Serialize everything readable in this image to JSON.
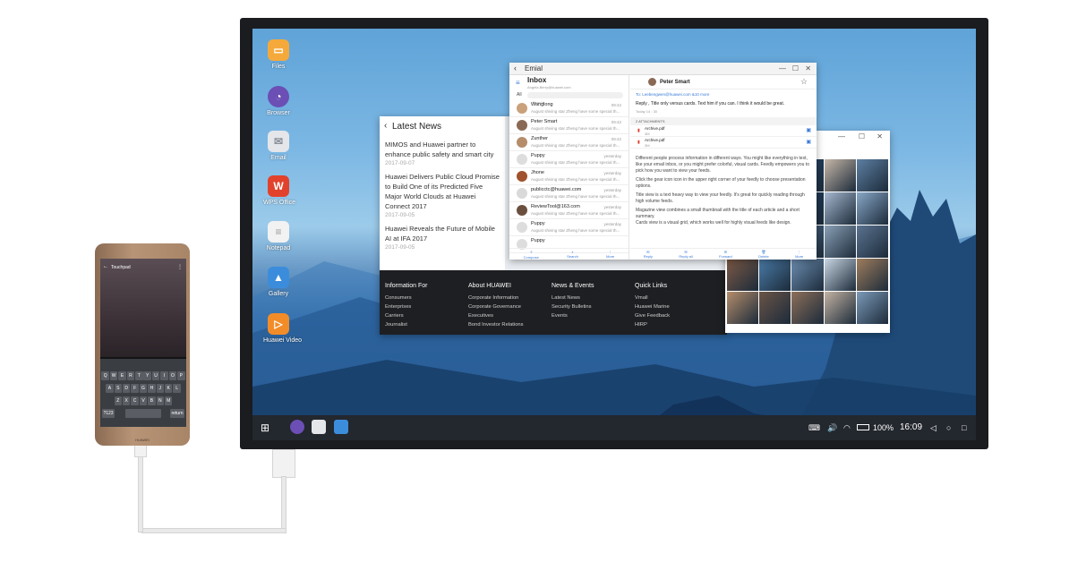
{
  "desktop": {
    "icons": [
      {
        "label": "Files",
        "color": "#f5a93b",
        "icon": "folder-icon"
      },
      {
        "label": "Browser",
        "color": "#6b4fb5",
        "icon": "browser-icon"
      },
      {
        "label": "Email",
        "color": "#e4e6ea",
        "icon": "mail-icon"
      },
      {
        "label": "WPS Office",
        "color": "#e2422c",
        "icon": "wps-icon"
      },
      {
        "label": "Notepad",
        "color": "#f2f2f2",
        "icon": "notepad-icon"
      },
      {
        "label": "Gallery",
        "color": "#3b8ddc",
        "icon": "gallery-icon"
      },
      {
        "label": "Huawei Video",
        "color": "#f28c28",
        "icon": "video-play-icon"
      }
    ]
  },
  "taskbar": {
    "battery": "100%",
    "time": "16:09"
  },
  "news": {
    "title": "Latest News",
    "items": [
      {
        "text": "MIMOS and Huawei partner to enhance public safety and smart city",
        "date": "2017-09-07"
      },
      {
        "text": "Huawei Delivers Public Cloud Promise to Build One of its Predicted Five Major World Clouds at Huawei Connect 2017",
        "date": "2017-09-05"
      },
      {
        "text": "Huawei Reveals the Future of Mobile AI at IFA 2017",
        "date": "2017-09-05"
      }
    ],
    "footer": [
      {
        "heading": "Information For",
        "items": [
          "Consumers",
          "Enterprises",
          "Carriers",
          "Journalist"
        ]
      },
      {
        "heading": "About HUAWEI",
        "items": [
          "Corporate Information",
          "Corporate Governance",
          "Executives",
          "Bond Investor Relations"
        ]
      },
      {
        "heading": "News & Events",
        "items": [
          "Latest News",
          "Security Bulletins",
          "Events"
        ]
      },
      {
        "heading": "Quick Links",
        "items": [
          "Vmall",
          "Huawei Marine",
          "Give Feedback",
          "HIRP"
        ]
      }
    ]
  },
  "gallery": {
    "thumb_colors": [
      "#3a6f97",
      "#7a95b5",
      "#264a6e",
      "#c7b7a8",
      "#5d7fa2",
      "#2f5d87",
      "#6b8cae",
      "#1f3e5e",
      "#a6b8cf",
      "#88a7c7",
      "#3b6a8e",
      "#d1a56c",
      "#4f6e8d",
      "#8aa0b6",
      "#5b7390",
      "#7e5a46",
      "#4b7ca9",
      "#6c8fb3",
      "#c9d6e4",
      "#9f7d5d",
      "#b58d6b",
      "#6a5447",
      "#8d6f5a",
      "#c4b3a3",
      "#7c9ab9"
    ]
  },
  "email": {
    "title": "Emial",
    "folder": "Inbox",
    "account": "Angela.Berry@huawei.com",
    "filter": "All",
    "search_placeholder": "Search",
    "messages": [
      {
        "name": "Wanglong",
        "preview": "August shiving star Zheng have some special th...",
        "time": "09:42",
        "color": "#c9a17a"
      },
      {
        "name": "Peter Smart",
        "preview": "August shiving star Zheng have some special th...",
        "time": "09:42",
        "color": "#8a6a55"
      },
      {
        "name": "Zunther",
        "preview": "August shiving star Zheng have some special th...",
        "time": "09:42",
        "color": "#b58d6b"
      },
      {
        "name": "Puppy",
        "preview": "August shiving star Zheng have some special th...",
        "time": "yesterday",
        "color": "#ddd"
      },
      {
        "name": "Jhone",
        "preview": "August shiving star Zheng have some special th...",
        "time": "yesterday",
        "color": "#a0522d"
      },
      {
        "name": "publicctc@huawei.com",
        "preview": "August shiving star Zheng have some special th...",
        "time": "yesterday",
        "color": "#d9d9d9"
      },
      {
        "name": "ReviewTool@163.com",
        "preview": "August shiving star Zheng have some special th...",
        "time": "yesterday",
        "color": "#6b4f3e"
      },
      {
        "name": "Puppy",
        "preview": "August shiving star Zheng have some special th...",
        "time": "yesterday",
        "color": "#ddd"
      },
      {
        "name": "Puppy",
        "preview": "",
        "time": "",
        "color": "#ddd"
      }
    ],
    "bottom_actions_left": [
      "Compose",
      "Search",
      "More"
    ],
    "bottom_actions_right": [
      "Reply",
      "Reply all",
      "Forward",
      "Delete",
      "More"
    ],
    "reader": {
      "sender": "Peter Smart",
      "to": "To: Leebengwen@huawei.com &10 more",
      "subject": "Reply , Title only versus cards. Text him if you can. I think it would be great.",
      "date": "Today 14 : 30",
      "attachments_label": "2 ATTACHMENTS",
      "attachments": [
        {
          "name": "Archive.pdf",
          "size": "3M"
        },
        {
          "name": "Archive.pdf",
          "size": "3M"
        }
      ],
      "body": [
        "Different people process information in different ways. You might like everything in text, like your email inbox, or you might prefer colorful, visual cards. Feedly empowers you to pick how you want to view your feeds.",
        "Click the gear icon icon in the upper right corner of your feedly to choose presentation options.",
        "Title view is a text heavy way to view your feedly. It's great for quickly reading through high volume feeds.",
        "Magazine view combines a small thumbnail with the title of each article and a short summary.",
        "Cards view is a visual grid, which works well for highly visual feeds like design."
      ]
    }
  },
  "phone": {
    "title": "Touchpad",
    "brand": "HUAWEI",
    "keyboard_rows": [
      [
        "Q",
        "W",
        "E",
        "R",
        "T",
        "Y",
        "U",
        "I",
        "O",
        "P"
      ],
      [
        "A",
        "S",
        "D",
        "F",
        "G",
        "H",
        "J",
        "K",
        "L"
      ],
      [
        "Z",
        "X",
        "C",
        "V",
        "B",
        "N",
        "M"
      ]
    ],
    "key_numbers": "?123",
    "key_return": "return"
  }
}
